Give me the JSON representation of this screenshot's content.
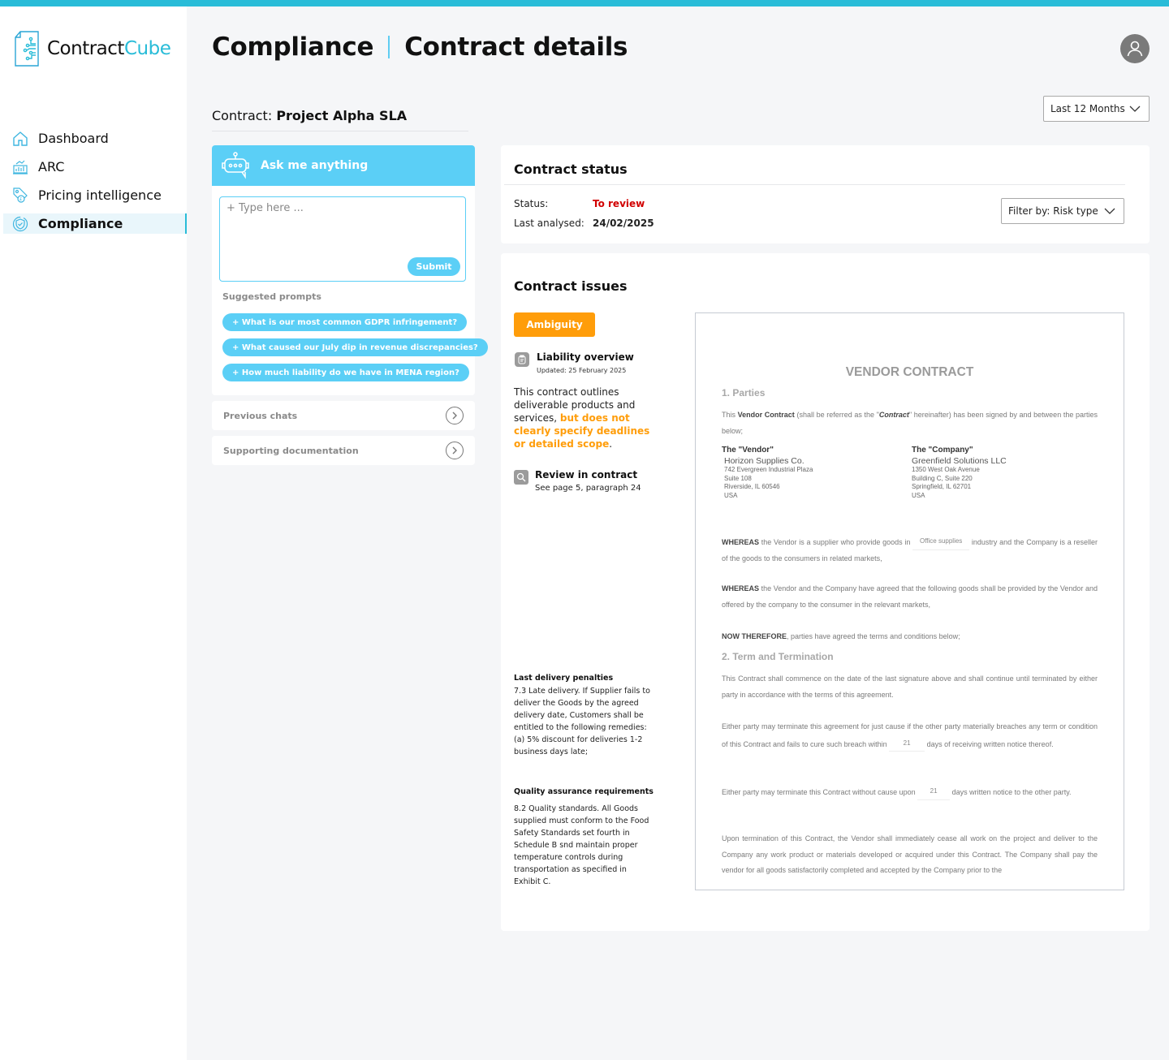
{
  "app": {
    "name_part1": "Contract",
    "name_part2": "Cube",
    "accent_color": "#29bcd8"
  },
  "sidebar": {
    "items": [
      {
        "label": "Dashboard",
        "icon": "home-icon",
        "active": false
      },
      {
        "label": "ARC",
        "icon": "bar-chart-icon",
        "active": false
      },
      {
        "label": "Pricing intelligence",
        "icon": "price-tag-icon",
        "active": false
      },
      {
        "label": "Compliance",
        "icon": "shield-check-icon",
        "active": true
      }
    ]
  },
  "header": {
    "section": "Compliance",
    "title": "Contract details",
    "avatar_icon": "user-icon",
    "period_select": {
      "value": "Last 12 Months"
    }
  },
  "contract": {
    "label": "Contract:",
    "name": "Project Alpha SLA"
  },
  "chat": {
    "title": "Ask me anything",
    "icon": "chatbot-icon",
    "input_placeholder": "+ Type here ...",
    "input_value": "",
    "submit_label": "Submit",
    "suggested_label": "Suggested prompts",
    "prompts": [
      "+ What is our most common GDPR infringement?",
      "+ What caused our July dip in revenue discrepancies?",
      "+ How much liability do we have in MENA region?"
    ],
    "previous_chats_label": "Previous chats",
    "supporting_docs_label": "Supporting documentation"
  },
  "status_card": {
    "title": "Contract status",
    "status_label": "Status:",
    "status_value": "To review",
    "status_color": "#d10000",
    "last_analysed_label": "Last analysed:",
    "last_analysed_value": "24/02/2025",
    "filter": {
      "value": "Filter by: Risk type"
    }
  },
  "issues_card": {
    "title": "Contract issues",
    "badge": "Ambiguity",
    "badge_color": "#ff9d0a",
    "liability": {
      "title": "Liability overview",
      "updated": "Updated: 25 February 2025",
      "desc_plain": "This contract outlines deliverable products and services, ",
      "desc_highlight": "but does not clearly specify deadlines or detailed scope",
      "desc_end": "."
    },
    "review": {
      "title": "Review in contract",
      "sub": "See page 5, paragraph 24"
    },
    "clauses": [
      {
        "title": "Last delivery penalties",
        "body": "7.3 Late delivery. If Supplier fails to deliver the Goods by the agreed delivery date, Customers shall be entitled to the following remedies:\n(a) 5% discount for deliveries 1-2 business days late;"
      },
      {
        "title": "Quality assurance requirements",
        "body": "8.2 Quality standards. All Goods supplied must conform to the Food Safety Standards set fourth in Schedule B snd maintain proper temperature controls during transportation as specified in Exhibit C."
      }
    ]
  },
  "document": {
    "title": "VENDOR CONTRACT",
    "s1_heading": "1. Parties",
    "s1_p1_a": "This ",
    "s1_p1_b": "Vendor Contract",
    "s1_p1_c": " (shall be referred as the \"",
    "s1_p1_d": "Contract",
    "s1_p1_e": "\" hereinafter) has been signed by and between the parties below;",
    "vendor": {
      "label": "The \"Vendor\"",
      "name": "Horizon Supplies Co.",
      "address": [
        "742 Evergreen Industrial Plaza",
        "Suite 108",
        "Riverside, IL 60546",
        "USA"
      ]
    },
    "company": {
      "label": "The \"Company\"",
      "name": "Greenfield Solutions LLC",
      "address": [
        "1350 West Oak Avenue",
        "Building C, Suite 220",
        "Springfield, IL 62701",
        "USA"
      ]
    },
    "whereas1_b": "WHEREAS",
    "whereas1_a": " the Vendor is a supplier who provide goods in ",
    "whereas1_blank": "Office supplies",
    "whereas1_c": " industry and the Company is a reseller of the goods to the consumers in related markets,",
    "whereas2_b": "WHEREAS",
    "whereas2_a": " the Vendor and the Company have agreed that the following goods shall be provided by the Vendor and offered by the company to the consumer in the relevant markets,",
    "now_b": "NOW THEREFORE",
    "now_a": ", parties have agreed the terms and conditions below;",
    "s2_heading": "2. Term and Termination",
    "s2_p1": "This Contract shall commence on the date of the last signature above and shall continue until terminated by either party in accordance with the terms of this agreement.",
    "s2_p2_a": "Either party may terminate this agreement for just cause if the other party materially breaches any term or condition of this Contract and fails to cure such breach within ",
    "s2_p2_blank": "21",
    "s2_p2_b": " days of receiving written notice thereof.",
    "s2_p3_a": "Either party may terminate this Contract without cause upon ",
    "s2_p3_blank": "21",
    "s2_p3_b": " days written notice to the other party.",
    "s2_p4": "Upon termination of this Contract, the Vendor shall immediately cease all work on the project and deliver to the Company any work product or materials developed or acquired under this Contract. The Company shall pay the vendor for all goods satisfactorily completed and accepted by the Company prior to the"
  }
}
